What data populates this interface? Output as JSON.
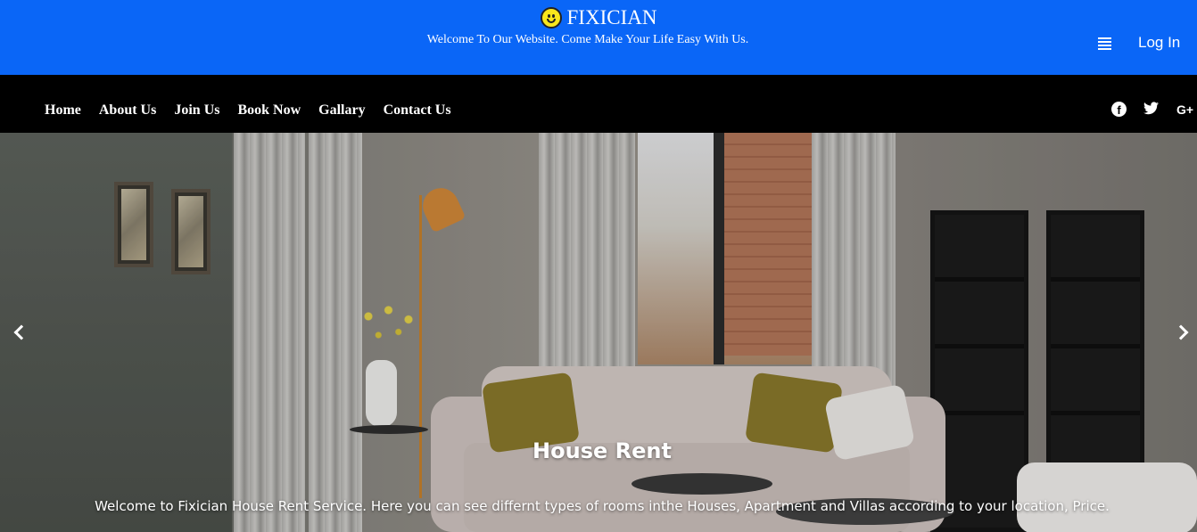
{
  "header": {
    "brand": "FIXICIAN",
    "brand_icon": "smiley-icon",
    "tagline": "Welcome To Our Website. Come Make Your Life Easy With Us.",
    "login_label": "Log In",
    "menu_icon": "hamburger-menu-icon",
    "bg_color": "#0a66f7"
  },
  "nav": {
    "items": [
      {
        "label": "Home"
      },
      {
        "label": "About Us"
      },
      {
        "label": "Join Us"
      },
      {
        "label": "Book Now"
      },
      {
        "label": "Gallary"
      },
      {
        "label": "Contact Us"
      }
    ],
    "social": {
      "facebook": "f",
      "twitter": "🐦",
      "google_plus": "G+"
    }
  },
  "hero": {
    "title": "House Rent",
    "description": "Welcome to Fixician House Rent Service. Here you can see differnt types of rooms inthe Houses, Apartment and Villas according to your location, Price."
  }
}
